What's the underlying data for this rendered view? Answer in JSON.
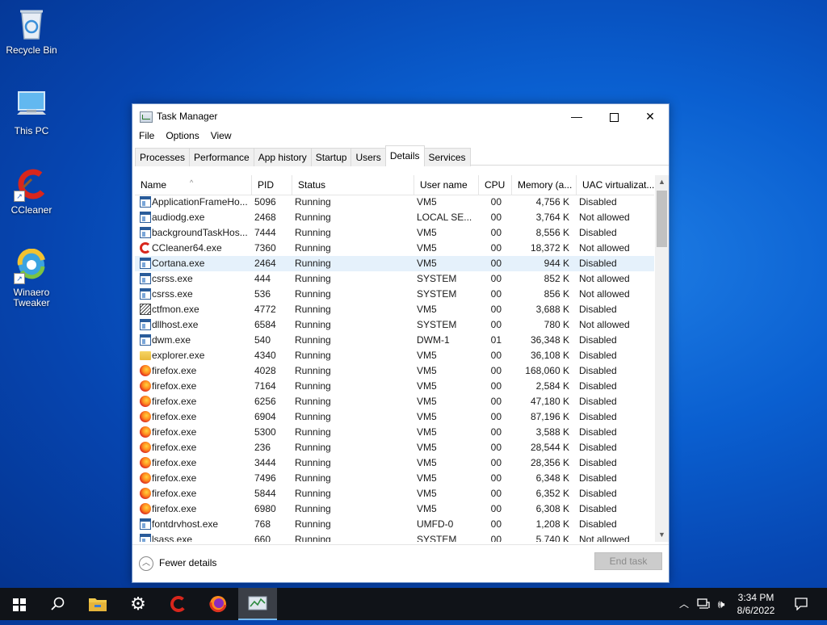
{
  "desktop": {
    "icons": [
      {
        "label": "Recycle Bin",
        "icon": "recycle-bin-icon"
      },
      {
        "label": "This PC",
        "icon": "computer-icon"
      },
      {
        "label": "CCleaner",
        "icon": "ccleaner-icon"
      },
      {
        "label": "Winaero Tweaker",
        "icon": "winaero-icon"
      }
    ]
  },
  "window": {
    "title": "Task Manager",
    "menu": [
      "File",
      "Options",
      "View"
    ],
    "tabs": [
      "Processes",
      "Performance",
      "App history",
      "Startup",
      "Users",
      "Details",
      "Services"
    ],
    "active_tab": "Details",
    "columns": [
      "Name",
      "PID",
      "Status",
      "User name",
      "CPU",
      "Memory (a...",
      "UAC virtualizat..."
    ],
    "rows": [
      {
        "name": "ApplicationFrameHo...",
        "pid": "5096",
        "status": "Running",
        "user": "VM5",
        "cpu": "00",
        "mem": "4,756 K",
        "uac": "Disabled",
        "icon": "window"
      },
      {
        "name": "audiodg.exe",
        "pid": "2468",
        "status": "Running",
        "user": "LOCAL SE...",
        "cpu": "00",
        "mem": "3,764 K",
        "uac": "Not allowed",
        "icon": "window"
      },
      {
        "name": "backgroundTaskHos...",
        "pid": "7444",
        "status": "Running",
        "user": "VM5",
        "cpu": "00",
        "mem": "8,556 K",
        "uac": "Disabled",
        "icon": "window"
      },
      {
        "name": "CCleaner64.exe",
        "pid": "7360",
        "status": "Running",
        "user": "VM5",
        "cpu": "00",
        "mem": "18,372 K",
        "uac": "Not allowed",
        "icon": "ccleaner"
      },
      {
        "name": "Cortana.exe",
        "pid": "2464",
        "status": "Running",
        "user": "VM5",
        "cpu": "00",
        "mem": "944 K",
        "uac": "Disabled",
        "icon": "window",
        "selected": true
      },
      {
        "name": "csrss.exe",
        "pid": "444",
        "status": "Running",
        "user": "SYSTEM",
        "cpu": "00",
        "mem": "852 K",
        "uac": "Not allowed",
        "icon": "window"
      },
      {
        "name": "csrss.exe",
        "pid": "536",
        "status": "Running",
        "user": "SYSTEM",
        "cpu": "00",
        "mem": "856 K",
        "uac": "Not allowed",
        "icon": "window"
      },
      {
        "name": "ctfmon.exe",
        "pid": "4772",
        "status": "Running",
        "user": "VM5",
        "cpu": "00",
        "mem": "3,688 K",
        "uac": "Disabled",
        "icon": "pen"
      },
      {
        "name": "dllhost.exe",
        "pid": "6584",
        "status": "Running",
        "user": "SYSTEM",
        "cpu": "00",
        "mem": "780 K",
        "uac": "Not allowed",
        "icon": "window"
      },
      {
        "name": "dwm.exe",
        "pid": "540",
        "status": "Running",
        "user": "DWM-1",
        "cpu": "01",
        "mem": "36,348 K",
        "uac": "Disabled",
        "icon": "window"
      },
      {
        "name": "explorer.exe",
        "pid": "4340",
        "status": "Running",
        "user": "VM5",
        "cpu": "00",
        "mem": "36,108 K",
        "uac": "Disabled",
        "icon": "folder"
      },
      {
        "name": "firefox.exe",
        "pid": "4028",
        "status": "Running",
        "user": "VM5",
        "cpu": "00",
        "mem": "168,060 K",
        "uac": "Disabled",
        "icon": "firefox"
      },
      {
        "name": "firefox.exe",
        "pid": "7164",
        "status": "Running",
        "user": "VM5",
        "cpu": "00",
        "mem": "2,584 K",
        "uac": "Disabled",
        "icon": "firefox"
      },
      {
        "name": "firefox.exe",
        "pid": "6256",
        "status": "Running",
        "user": "VM5",
        "cpu": "00",
        "mem": "47,180 K",
        "uac": "Disabled",
        "icon": "firefox"
      },
      {
        "name": "firefox.exe",
        "pid": "6904",
        "status": "Running",
        "user": "VM5",
        "cpu": "00",
        "mem": "87,196 K",
        "uac": "Disabled",
        "icon": "firefox"
      },
      {
        "name": "firefox.exe",
        "pid": "5300",
        "status": "Running",
        "user": "VM5",
        "cpu": "00",
        "mem": "3,588 K",
        "uac": "Disabled",
        "icon": "firefox"
      },
      {
        "name": "firefox.exe",
        "pid": "236",
        "status": "Running",
        "user": "VM5",
        "cpu": "00",
        "mem": "28,544 K",
        "uac": "Disabled",
        "icon": "firefox"
      },
      {
        "name": "firefox.exe",
        "pid": "3444",
        "status": "Running",
        "user": "VM5",
        "cpu": "00",
        "mem": "28,356 K",
        "uac": "Disabled",
        "icon": "firefox"
      },
      {
        "name": "firefox.exe",
        "pid": "7496",
        "status": "Running",
        "user": "VM5",
        "cpu": "00",
        "mem": "6,348 K",
        "uac": "Disabled",
        "icon": "firefox"
      },
      {
        "name": "firefox.exe",
        "pid": "5844",
        "status": "Running",
        "user": "VM5",
        "cpu": "00",
        "mem": "6,352 K",
        "uac": "Disabled",
        "icon": "firefox"
      },
      {
        "name": "firefox.exe",
        "pid": "6980",
        "status": "Running",
        "user": "VM5",
        "cpu": "00",
        "mem": "6,308 K",
        "uac": "Disabled",
        "icon": "firefox"
      },
      {
        "name": "fontdrvhost.exe",
        "pid": "768",
        "status": "Running",
        "user": "UMFD-0",
        "cpu": "00",
        "mem": "1,208 K",
        "uac": "Disabled",
        "icon": "window"
      },
      {
        "name": "lsass.exe",
        "pid": "660",
        "status": "Running",
        "user": "SYSTEM",
        "cpu": "00",
        "mem": "5,740 K",
        "uac": "Not allowed",
        "icon": "window"
      }
    ],
    "footer": {
      "fewer_details": "Fewer details",
      "end_task": "End task"
    }
  },
  "taskbar": {
    "items": [
      "start-icon",
      "search-icon",
      "file-explorer-icon",
      "settings-icon",
      "ccleaner-icon",
      "firefox-icon",
      "task-manager-icon"
    ],
    "active_item": "task-manager-icon",
    "time": "3:34 PM",
    "date": "8/6/2022"
  }
}
